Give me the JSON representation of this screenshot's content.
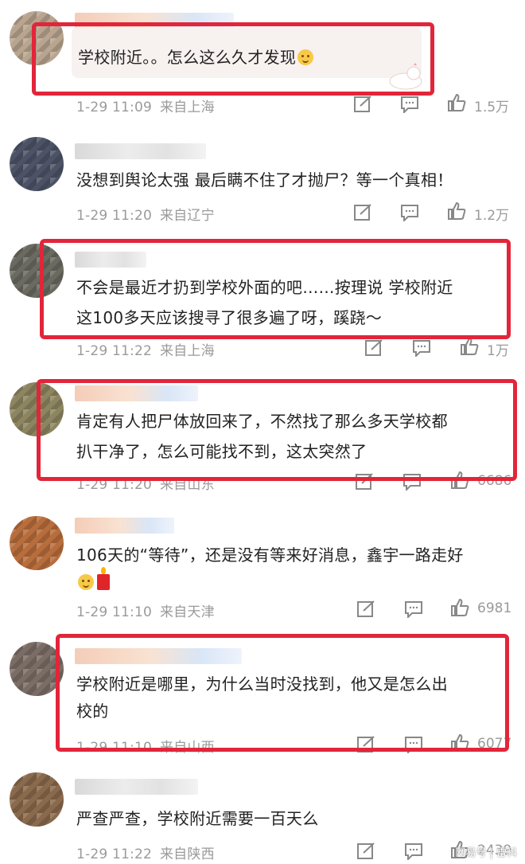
{
  "colors": {
    "highlight": "#e2253a",
    "meta": "#9a9a9a",
    "text": "#222222"
  },
  "comments": [
    {
      "text": "学校附近。。怎么这么久才发现",
      "emoji": "smile-emoji",
      "time": "1-29 11:09",
      "location": "来自上海",
      "likes": "1.5万"
    },
    {
      "text": "没想到舆论太强 最后瞒不住了才抛尸？等一个真相！",
      "time": "1-29 11:20",
      "location": "来自辽宁",
      "likes": "1.2万"
    },
    {
      "text_line1": "不会是最近才扔到学校外面的吧……按理说 学校附近",
      "text_line2": "这100多天应该搜寻了很多遍了呀，蹊跷～",
      "time": "1-29 11:22",
      "location": "来自上海",
      "likes": "1万"
    },
    {
      "text_line1": "肯定有人把尸体放回来了，不然找了那么多天学校都",
      "text_line2": "扒干净了，怎么可能找不到，这太突然了",
      "time": "1-29 11:20",
      "location": "来自山东",
      "likes": "6686"
    },
    {
      "text": "106天的“等待”，还是没有等来好消息，鑫宇一路走好",
      "time": "1-29 11:10",
      "location": "来自天津",
      "likes": "6981"
    },
    {
      "text_line1": "学校附近是哪里，为什么当时没找到，他又是怎么出",
      "text_line2": "校的",
      "time": "1-29 11:10",
      "location": "来自山西",
      "likes": "6077"
    },
    {
      "text": "严查严查，学校附近需要一百天么",
      "time": "1-29 11:22",
      "location": "来自陕西",
      "likes": "2439"
    }
  ],
  "watermark": "网易号 | 雷科"
}
